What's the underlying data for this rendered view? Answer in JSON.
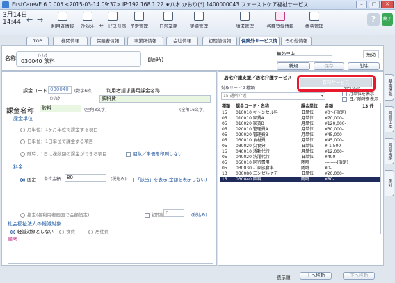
{
  "window": {
    "title": "FirstCareVE 6.0.005 <2015-03-14 09:37>     IP:192.168.1.22 ★八木 かおり(*) 1400000043 ファーストケア福祉サービス"
  },
  "toolbar": {
    "date": "3月14日",
    "time": "14:44",
    "items": [
      {
        "label": "利用者情報"
      },
      {
        "label": "ｱｾｽﾒﾝﾄ"
      },
      {
        "label": "サービス計画"
      },
      {
        "label": "予定管理"
      },
      {
        "label": "日常業務"
      },
      {
        "label": "実績管理"
      },
      {
        "label": "請求管理"
      },
      {
        "label": "各種登録情報"
      },
      {
        "label": "帳票管理"
      }
    ],
    "help": "?",
    "exit": "終了"
  },
  "tabs": [
    "TOP",
    "機関情報",
    "保険者情報",
    "事業所情報",
    "会社情報",
    "初期値情報",
    "保険外サービス情報",
    "その他情報"
  ],
  "header": {
    "name_label": "名称",
    "kana": "ｲﾝﾘｮｳ",
    "code_name": "030040 飲料",
    "rinji": "【随時】",
    "muko_label": "無効理由",
    "muko_chk": "無効",
    "buttons": {
      "new": "新規",
      "save": "保存",
      "delete": "削除"
    }
  },
  "form": {
    "code_label": "課金コード",
    "code_value": "030040",
    "code_hint": "(数字6桁)",
    "user_name_label": "利用者請求書用課金名称",
    "kana_value": "ｲﾝﾘｮｳ",
    "user_name_value": "飲料費",
    "kakin_label": "課金名称",
    "kakin_value": "飲料",
    "zenkaku8": "(全角8文字)",
    "zenkaku16": "(全角16文字)",
    "unit_section": "課金単位",
    "radio_month": "月単位：1ヶ月単位で課金する項目",
    "radio_day": "日単位：1日単位で課金する項目",
    "radio_anytime": "随時：1日に複数回の課金ができる項目",
    "chk_kaisu": "回数／単価を印刷しない",
    "fee_section": "料金",
    "radio_fixed": "固定",
    "unit_price_label": "単位金額",
    "unit_price_value": "80",
    "tax_incl": "(税込み)",
    "chk_sonota": "「該当」を表示(金額を表示しない)",
    "radio_designated": "指定(各利用者画面で金額設定)",
    "initial_label": "初期値",
    "initial_value": "0",
    "tax_incl2": "(税込み)",
    "social_section": "社会福祉法人の軽減対象",
    "radio_not_target": "軽減対象としない",
    "radio_food": "食費",
    "radio_residence": "居住費",
    "notes_section": "備考"
  },
  "right": {
    "tab1": "居宅介護支援／居宅介護サービス",
    "tab2": "有料サービス",
    "type_label": "対象サービス種類",
    "dropdown": "15:通所介護",
    "chk1": "随時表示",
    "chk2": "月単位を表示",
    "chk3": "日／随時を表示",
    "headers": {
      "type": "種類",
      "code": "課金コード・名称",
      "unit": "課金単位",
      "amount": "金額",
      "count": "13 件"
    },
    "rows": [
      {
        "type": "15",
        "code": "010010 キャンセル料",
        "unit": "日単位",
        "amount": "¥0～(指定)"
      },
      {
        "type": "05",
        "code": "010010 家賃A",
        "unit": "月単位",
        "amount": "¥70,000-"
      },
      {
        "type": "05",
        "code": "010020 家賃B",
        "unit": "月単位",
        "amount": "¥120,000-"
      },
      {
        "type": "05",
        "code": "020010 管理費A",
        "unit": "月単位",
        "amount": "¥30,000-"
      },
      {
        "type": "05",
        "code": "020020 管理費B",
        "unit": "月単位",
        "amount": "¥45,000-"
      },
      {
        "type": "05",
        "code": "030010 食材費",
        "unit": "月単位",
        "amount": "¥45,000-"
      },
      {
        "type": "05",
        "code": "030020 欠食分",
        "unit": "日単位",
        "amount": "¥-1,500-"
      },
      {
        "type": "15",
        "code": "040010 活動代行",
        "unit": "月単位",
        "amount": "¥12,000-"
      },
      {
        "type": "05",
        "code": "040020 洗濯代行",
        "unit": "日単位",
        "amount": "¥400-"
      },
      {
        "type": "05",
        "code": "050010 同行费用",
        "unit": "随時",
        "amount": "--------(指定)"
      },
      {
        "type": "05",
        "code": "030030 ご家族食事",
        "unit": "随時",
        "amount": "¥0-"
      },
      {
        "type": "13",
        "code": "030080 エンゼルケア",
        "unit": "日単位",
        "amount": "¥20,000-"
      },
      {
        "type": "15",
        "code": "030040 飲料",
        "unit": "随時",
        "amount": "¥80-"
      }
    ],
    "display_label": "表示順:",
    "up_btn": "上へ移動",
    "down_btn": "下へ移動"
  },
  "side_tabs": [
    "基本情報",
    "月間予定",
    "月間実績",
    "集計"
  ],
  "colors": {
    "highlight": "#e8192c",
    "selected_row": "#1f2b5a",
    "accent": "#1c5aa3"
  }
}
